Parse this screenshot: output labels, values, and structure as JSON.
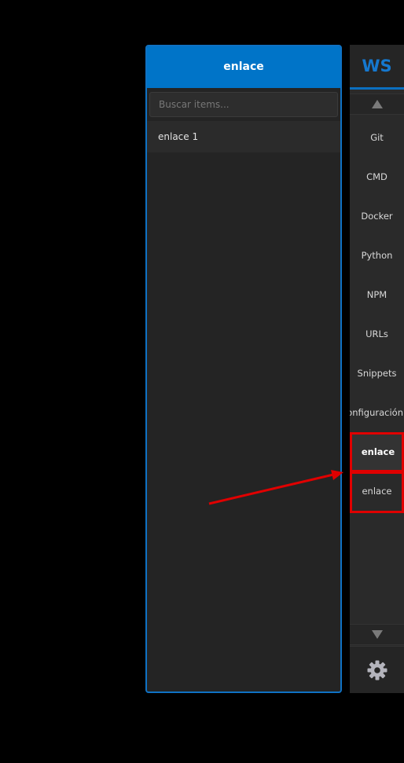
{
  "panel": {
    "title": "enlace",
    "search_placeholder": "Buscar items...",
    "items": [
      "enlace 1"
    ]
  },
  "dock": {
    "logo": "WS",
    "items": [
      {
        "label": "Git"
      },
      {
        "label": "CMD"
      },
      {
        "label": "Docker"
      },
      {
        "label": "Python"
      },
      {
        "label": "NPM"
      },
      {
        "label": "URLs"
      },
      {
        "label": "Snippets"
      },
      {
        "label": "Configuración"
      },
      {
        "label": "enlace",
        "active": true
      },
      {
        "label": "enlace"
      }
    ],
    "icons": {
      "scroll_up": "triangle-up-icon",
      "scroll_down": "triangle-down-icon",
      "settings": "gear-icon"
    }
  },
  "colors": {
    "accent": "#0074c8",
    "logo": "#1578cf",
    "annotation": "#e00000",
    "panel_bg": "#242424",
    "dock_bg": "#2a2a2a"
  }
}
